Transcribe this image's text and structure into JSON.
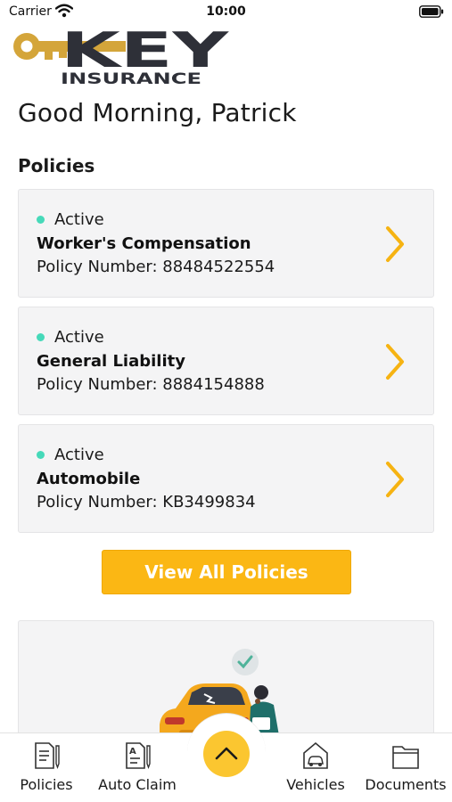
{
  "status_bar": {
    "carrier": "Carrier",
    "time": "10:00"
  },
  "logo": {
    "word": "KEY",
    "subtitle": "INSURANCE"
  },
  "greeting": "Good Morning, Patrick",
  "policies_section": {
    "title": "Policies",
    "items": [
      {
        "status": "Active",
        "name": "Worker's Compensation",
        "number": "Policy Number: 88484522554"
      },
      {
        "status": "Active",
        "name": "General Liability",
        "number": "Policy Number: 8884154888"
      },
      {
        "status": "Active",
        "name": "Automobile",
        "number": "Policy Number: KB3499834"
      }
    ],
    "view_all_label": "View All Policies"
  },
  "tab_bar": {
    "items": [
      {
        "label": "Policies",
        "icon": "policies-document-icon"
      },
      {
        "label": "Auto Claim",
        "icon": "auto-claim-document-icon"
      },
      {
        "label": "Vehicles",
        "icon": "vehicles-garage-icon"
      },
      {
        "label": "Documents",
        "icon": "documents-folder-icon"
      }
    ],
    "center_button_icon": "chevron-up-icon"
  },
  "colors": {
    "accent": "#fbb714",
    "logo_gold": "#d4a53a",
    "logo_dark": "#2e3038",
    "active_dot": "#46d9b9",
    "card_background": "#f4f4f5"
  }
}
